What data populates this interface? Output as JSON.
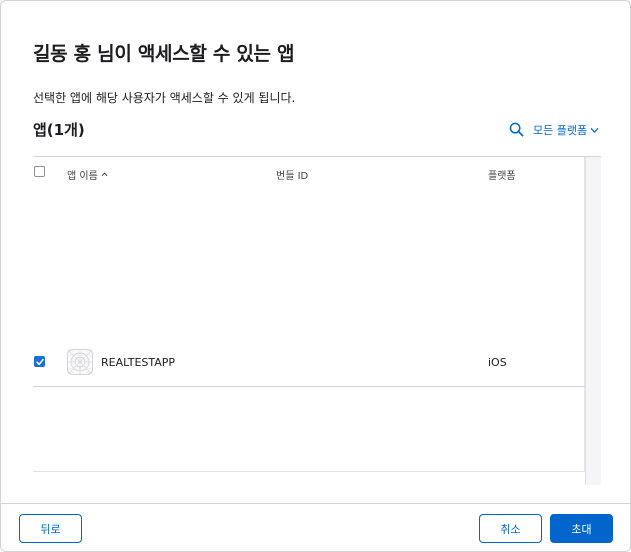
{
  "dialog": {
    "title": "길동 홍 님이 액세스할 수 있는 앱",
    "subtitle": "선택한 앱에 해당 사용자가 액세스할 수 있게 됩니다."
  },
  "apps_section": {
    "title": "앱(1개)",
    "platform_filter": "모든 플랫폼"
  },
  "table": {
    "columns": [
      "앱 이름",
      "번들 ID",
      "플랫폼"
    ],
    "rows": [
      {
        "name": "REALTESTAPP",
        "bundle_id": "",
        "platform": "iOS",
        "checked": true
      }
    ]
  },
  "footer": {
    "back_label": "뒤로",
    "cancel_label": "취소",
    "invite_label": "초대"
  },
  "colors": {
    "accent": "#0066cc"
  }
}
